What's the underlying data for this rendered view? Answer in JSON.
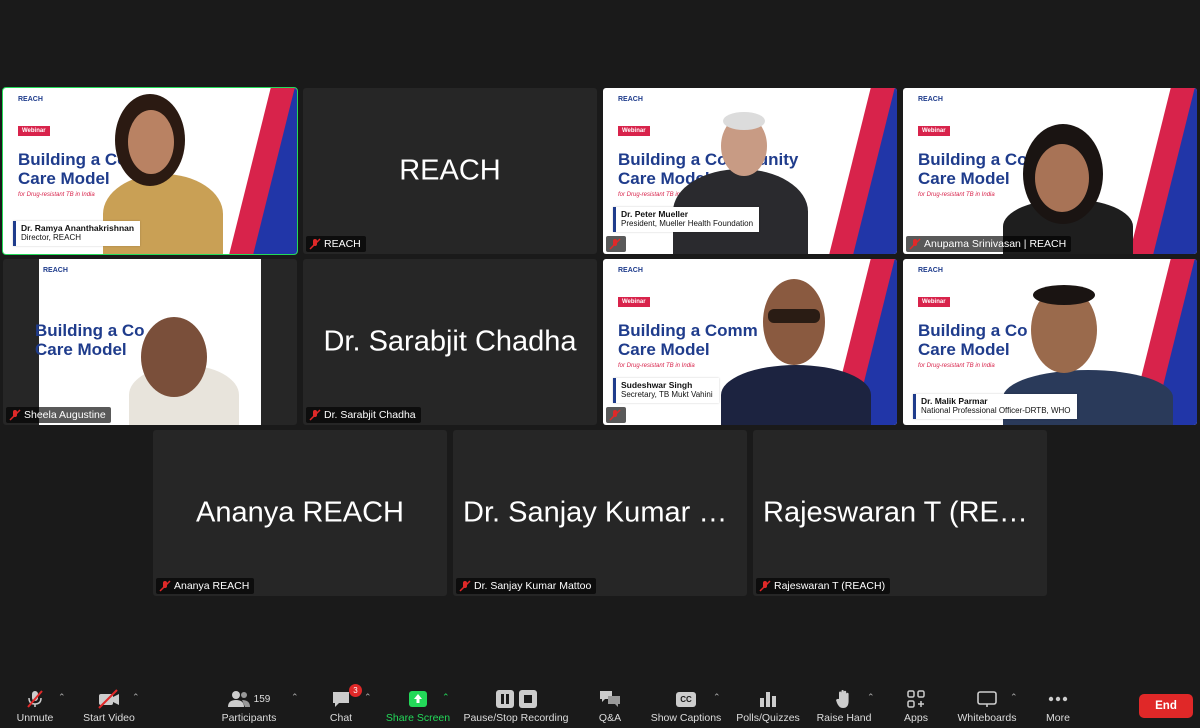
{
  "tiles": {
    "ramya": {
      "name": "Dr. Ramya Ananthakrishnan",
      "lower_title": "Dr. Ramya Ananthakrishnan",
      "lower_sub": "Director, REACH"
    },
    "reach": {
      "center": "REACH",
      "tag": "REACH"
    },
    "peter": {
      "lower_title": "Dr. Peter Mueller",
      "lower_sub": "President, Mueller Health Foundation"
    },
    "anupama": {
      "tag": "Anupama Srinivasan | REACH"
    },
    "sheela": {
      "tag": "Sheela Augustine"
    },
    "sarabjit": {
      "center": "Dr. Sarabjit Chadha",
      "tag": "Dr. Sarabjit Chadha"
    },
    "sudeshwar": {
      "lower_title": "Sudeshwar Singh",
      "lower_sub": "Secretary, TB Mukt Vahini"
    },
    "malik": {
      "lower_title": "Dr. Malik Parmar",
      "lower_sub": "National Professional Officer-DRTB, WHO"
    },
    "ananya": {
      "center": "Ananya REACH",
      "tag": "Ananya REACH"
    },
    "sanjay": {
      "center": "Dr. Sanjay Kumar M...",
      "tag": "Dr. Sanjay Kumar Mattoo"
    },
    "rajeswaran": {
      "center": "Rajeswaran T (REA...",
      "tag": "Rajeswaran T (REACH)"
    }
  },
  "slide": {
    "webinar": "Webinar",
    "line1_a": "Building a Co",
    "line1_b": "Building a Community",
    "line1_c": "Building a Comm",
    "line2": "Care Model",
    "sub": "for Drug-resistant TB in India",
    "logo": "REACH"
  },
  "toolbar": {
    "unmute": "Unmute",
    "start_video": "Start Video",
    "participants": "Participants",
    "participants_count": "159",
    "chat": "Chat",
    "chat_badge": "3",
    "share": "Share Screen",
    "record": "Pause/Stop Recording",
    "qa": "Q&A",
    "captions": "Show Captions",
    "captions_icon": "CC",
    "polls": "Polls/Quizzes",
    "raise": "Raise Hand",
    "apps": "Apps",
    "whiteboards": "Whiteboards",
    "more": "More",
    "end": "End"
  },
  "colors": {
    "active_speaker": "#23d959",
    "share": "#23d959",
    "end": "#e02828",
    "slide_blue": "#1f3c8c",
    "slide_red": "#d8234b"
  }
}
